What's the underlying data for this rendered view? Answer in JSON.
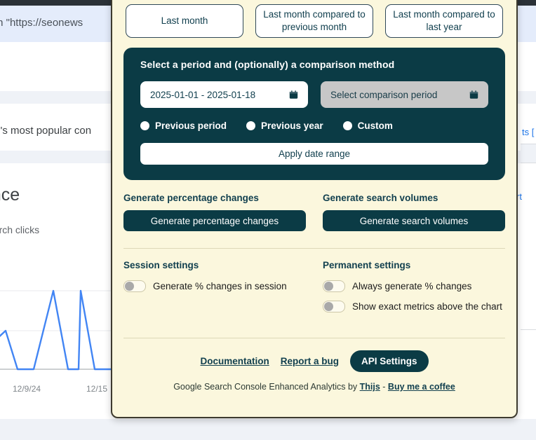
{
  "background": {
    "notice_text": "RL in \"https://seonews",
    "row_text": "r site's most popular con",
    "performance_title": "ance",
    "performance_subtitle": "search clicks",
    "right_text_top": "ts  [",
    "right_text_mid": "rt",
    "chart": {
      "xlabels": [
        "12/9/24",
        "12/15"
      ],
      "line_color": "#4285f4"
    }
  },
  "panel": {
    "presets": [
      {
        "label": "Last month"
      },
      {
        "label": "Last month compared to previous month"
      },
      {
        "label": "Last month compared to last year"
      }
    ],
    "period_card": {
      "title": "Select a period and (optionally) a comparison method",
      "date_value": "2025-01-01 - 2025-01-18",
      "comparison_placeholder": "Select comparison period",
      "radios": [
        {
          "label": "Previous period",
          "selected": false
        },
        {
          "label": "Previous year",
          "selected": false
        },
        {
          "label": "Custom",
          "selected": false
        }
      ],
      "apply_label": "Apply date range"
    },
    "generate": {
      "percentage_heading": "Generate percentage changes",
      "percentage_button": "Generate percentage changes",
      "volumes_heading": "Generate search volumes",
      "volumes_button": "Generate search volumes"
    },
    "settings": {
      "session_heading": "Session settings",
      "session_toggles": [
        {
          "label": "Generate % changes in session",
          "on": false
        }
      ],
      "permanent_heading": "Permanent settings",
      "permanent_toggles": [
        {
          "label": "Always generate % changes",
          "on": false
        },
        {
          "label": "Show exact metrics above the chart",
          "on": false
        }
      ]
    },
    "footer": {
      "documentation": "Documentation",
      "report_bug": "Report a bug",
      "api_settings": "API Settings",
      "credit_prefix": "Google Search Console Enhanced Analytics by ",
      "credit_author": "Thijs",
      "credit_separator": " - ",
      "credit_coffee": "Buy me a coffee"
    }
  },
  "colors": {
    "panel_bg": "#fbf7dd",
    "dark": "#0b3b45",
    "accent_text": "#12404f"
  }
}
